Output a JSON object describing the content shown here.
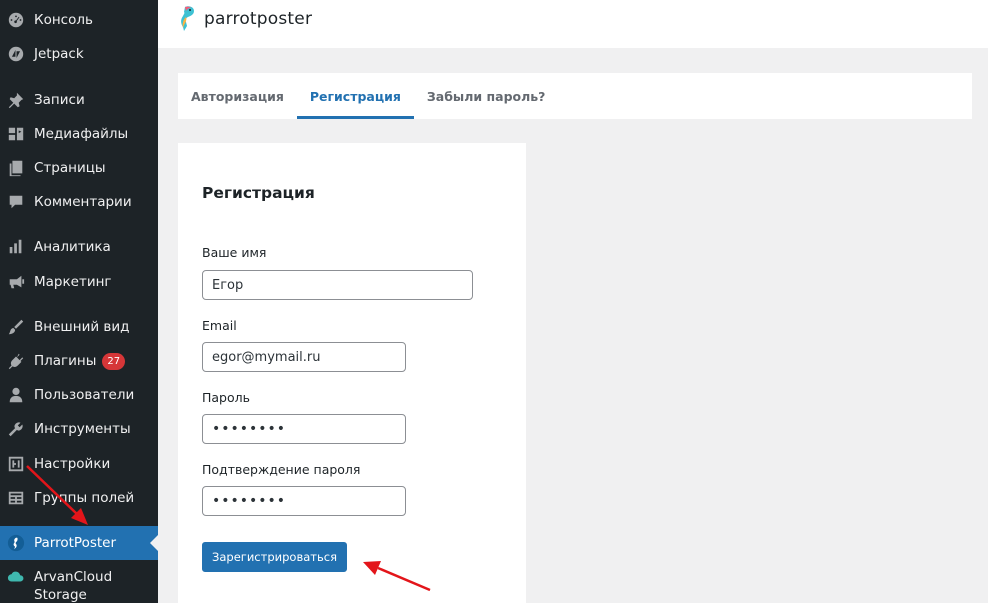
{
  "sidebar": {
    "items": [
      {
        "label": "Консоль",
        "icon": "dashboard-icon"
      },
      {
        "label": "Jetpack",
        "icon": "jetpack-icon"
      },
      {
        "label": "Записи",
        "icon": "pin-icon"
      },
      {
        "label": "Медиафайлы",
        "icon": "media-icon"
      },
      {
        "label": "Страницы",
        "icon": "pages-icon"
      },
      {
        "label": "Комментарии",
        "icon": "comment-icon"
      },
      {
        "label": "Аналитика",
        "icon": "analytics-icon"
      },
      {
        "label": "Маркетинг",
        "icon": "megaphone-icon"
      },
      {
        "label": "Внешний вид",
        "icon": "brush-icon"
      },
      {
        "label": "Плагины",
        "icon": "plugin-icon",
        "badge": "27"
      },
      {
        "label": "Пользователи",
        "icon": "user-icon"
      },
      {
        "label": "Инструменты",
        "icon": "wrench-icon"
      },
      {
        "label": "Настройки",
        "icon": "settings-icon"
      },
      {
        "label": "Группы полей",
        "icon": "table-icon"
      },
      {
        "label": "ParrotPoster",
        "icon": "parrotposter-icon",
        "active": true
      },
      {
        "label": "ArvanCloud Storage",
        "icon": "cloud-icon"
      }
    ]
  },
  "header": {
    "logo_text": "parrotposter"
  },
  "tabs": [
    {
      "label": "Авторизация"
    },
    {
      "label": "Регистрация",
      "active": true
    },
    {
      "label": "Забыли пароль?"
    }
  ],
  "form": {
    "title": "Регистрация",
    "name_label": "Ваше имя",
    "name_value": "Егор",
    "email_label": "Email",
    "email_value": "egor@mymail.ru",
    "password_label": "Пароль",
    "password_value": "••••••••",
    "confirm_label": "Подтверждение пароля",
    "confirm_value": "••••••••",
    "submit_label": "Зарегистрироваться"
  },
  "colors": {
    "sidebar_bg": "#1d2327",
    "accent": "#2271b1",
    "badge": "#d63638",
    "annotation_arrow": "#e3151a"
  }
}
